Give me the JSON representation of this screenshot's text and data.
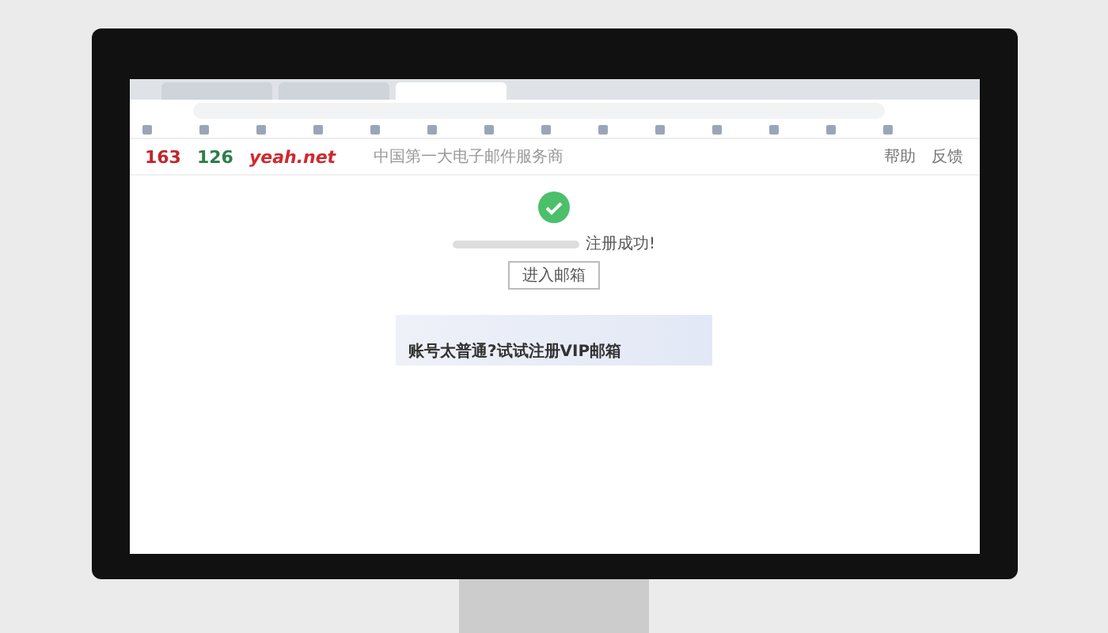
{
  "browser": {
    "tabs": [
      {
        "selected": false
      },
      {
        "selected": false
      },
      {
        "selected": true
      }
    ]
  },
  "header": {
    "logos": [
      {
        "text": "163",
        "kind": "red"
      },
      {
        "text": "126",
        "kind": "green"
      },
      {
        "text": "yeah.net",
        "kind": "italic"
      }
    ],
    "slogan": "中国第一大电子邮件服务商",
    "links": [
      "帮助",
      "反馈"
    ]
  },
  "success": {
    "message": "注册成功!",
    "button": "进入邮箱"
  },
  "banner": {
    "text": "账号太普通?试试注册VIP邮箱"
  }
}
